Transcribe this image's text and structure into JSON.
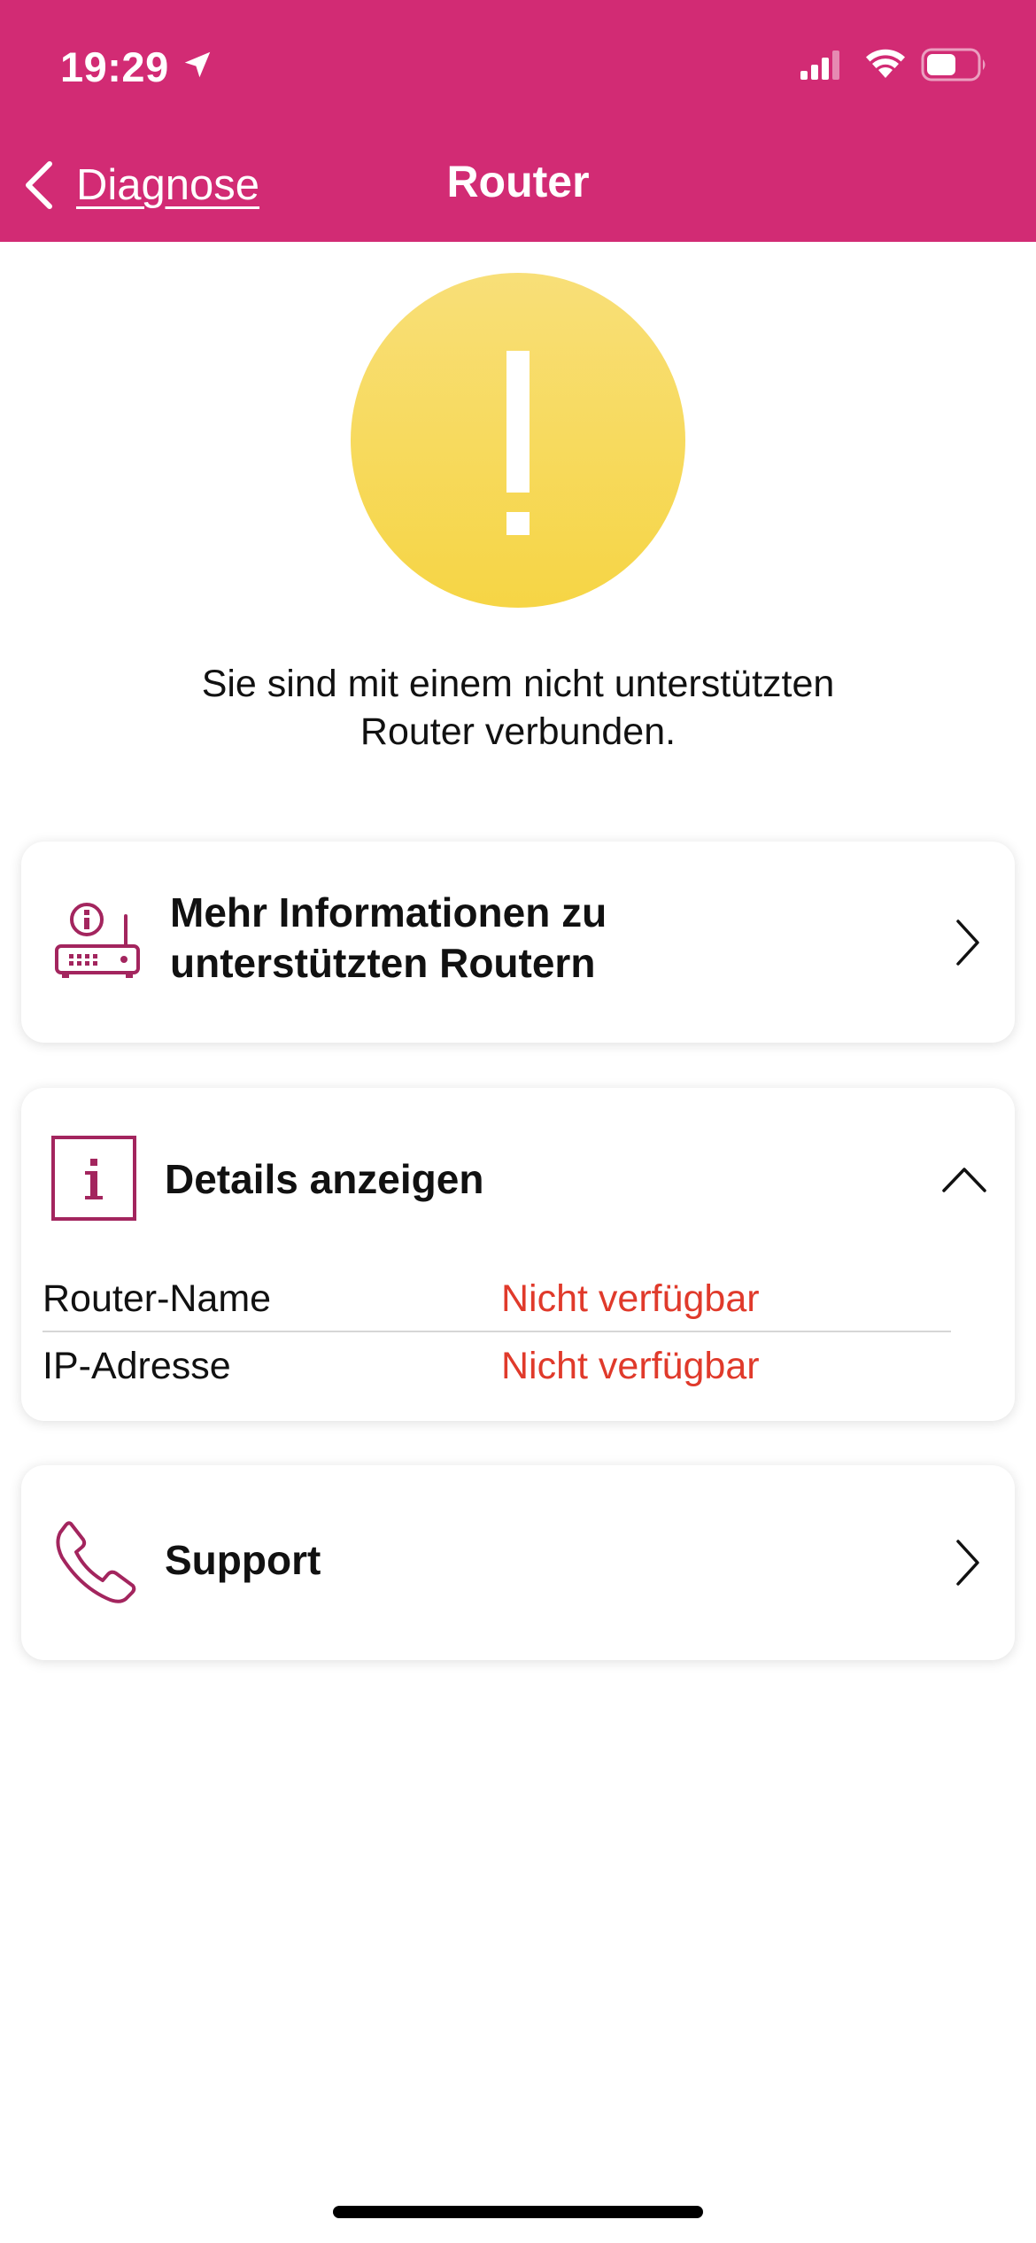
{
  "status_bar": {
    "time": "19:29",
    "icons": [
      "location-arrow-icon",
      "cellular-signal-icon",
      "wifi-icon",
      "battery-icon"
    ]
  },
  "nav": {
    "back_label": "Diagnose",
    "title": "Router",
    "icons": [
      "chevron-left-icon"
    ]
  },
  "warning": {
    "icon": "exclamation-icon",
    "message_line1": "Sie sind mit einem nicht unterstützten",
    "message_line2": "Router verbunden."
  },
  "info_card": {
    "icon": "router-info-icon",
    "title_line1": "Mehr Informationen zu",
    "title_line2": "unterstützten Routern"
  },
  "details_card": {
    "icon": "info-icon",
    "title": "Details anzeigen",
    "expanded": true,
    "rows": [
      {
        "label": "Router-Name",
        "value": "Nicht verfügbar"
      },
      {
        "label": "IP-Adresse",
        "value": "Nicht verfügbar"
      }
    ]
  },
  "support_card": {
    "icon": "phone-icon",
    "title": "Support"
  },
  "colors": {
    "brand": "#d22b74",
    "warning_yellow": "#f7d857",
    "error_red": "#e03a2b",
    "icon_accent": "#a3255e"
  }
}
